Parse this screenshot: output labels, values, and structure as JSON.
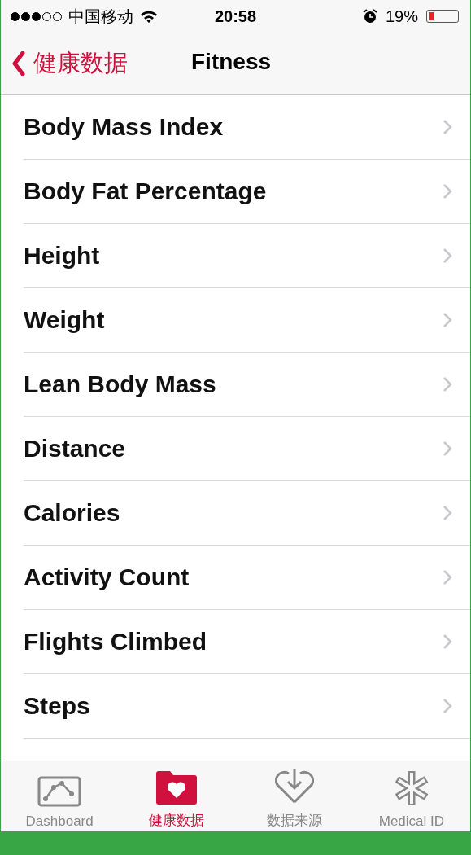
{
  "status_bar": {
    "carrier": "中国移动",
    "time": "20:58",
    "battery_percent": "19%",
    "signal_dots": [
      {
        "on": true
      },
      {
        "on": true
      },
      {
        "on": true
      },
      {
        "on": false
      },
      {
        "on": false
      }
    ]
  },
  "nav_bar": {
    "back_label": "健康数据",
    "title": "Fitness"
  },
  "items": [
    {
      "label": "Body Mass Index"
    },
    {
      "label": "Body Fat Percentage"
    },
    {
      "label": "Height"
    },
    {
      "label": "Weight"
    },
    {
      "label": "Lean Body Mass"
    },
    {
      "label": "Distance"
    },
    {
      "label": "Calories"
    },
    {
      "label": "Activity Count"
    },
    {
      "label": "Flights Climbed"
    },
    {
      "label": "Steps"
    }
  ],
  "tab_bar": [
    {
      "label": "Dashboard",
      "kind": "dashboard",
      "selected": false
    },
    {
      "label": "健康数据",
      "kind": "health",
      "selected": true
    },
    {
      "label": "数据来源",
      "kind": "sources",
      "selected": false
    },
    {
      "label": "Medical ID",
      "kind": "medical",
      "selected": false
    }
  ]
}
